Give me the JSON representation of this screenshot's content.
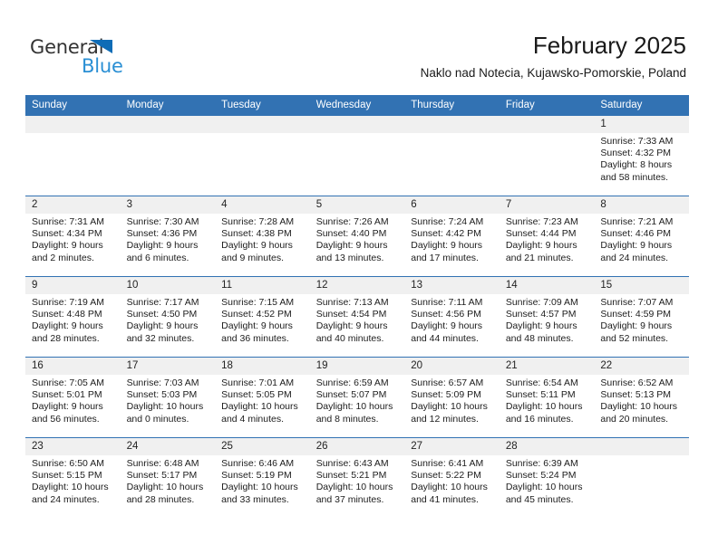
{
  "logo": {
    "word_one": "General",
    "word_two": "Blue",
    "triangle_color": "#0f6cb6",
    "blue_color": "#2a8fd4"
  },
  "header": {
    "title": "February 2025",
    "subtitle": "Naklo nad Notecia, Kujawsko-Pomorskie, Poland"
  },
  "theme": {
    "header_blue": "#3272b3",
    "daynum_gray": "#f0f0f0",
    "text": "#1c1c1c"
  },
  "calendar": {
    "weekday_headers": [
      "Sunday",
      "Monday",
      "Tuesday",
      "Wednesday",
      "Thursday",
      "Friday",
      "Saturday"
    ],
    "weeks": [
      [
        {
          "day": "",
          "blank": true
        },
        {
          "day": "",
          "blank": true
        },
        {
          "day": "",
          "blank": true
        },
        {
          "day": "",
          "blank": true
        },
        {
          "day": "",
          "blank": true
        },
        {
          "day": "",
          "blank": true
        },
        {
          "day": "1",
          "sunrise": "Sunrise: 7:33 AM",
          "sunset": "Sunset: 4:32 PM",
          "daylight": "Daylight: 8 hours and 58 minutes."
        }
      ],
      [
        {
          "day": "2",
          "sunrise": "Sunrise: 7:31 AM",
          "sunset": "Sunset: 4:34 PM",
          "daylight": "Daylight: 9 hours and 2 minutes."
        },
        {
          "day": "3",
          "sunrise": "Sunrise: 7:30 AM",
          "sunset": "Sunset: 4:36 PM",
          "daylight": "Daylight: 9 hours and 6 minutes."
        },
        {
          "day": "4",
          "sunrise": "Sunrise: 7:28 AM",
          "sunset": "Sunset: 4:38 PM",
          "daylight": "Daylight: 9 hours and 9 minutes."
        },
        {
          "day": "5",
          "sunrise": "Sunrise: 7:26 AM",
          "sunset": "Sunset: 4:40 PM",
          "daylight": "Daylight: 9 hours and 13 minutes."
        },
        {
          "day": "6",
          "sunrise": "Sunrise: 7:24 AM",
          "sunset": "Sunset: 4:42 PM",
          "daylight": "Daylight: 9 hours and 17 minutes."
        },
        {
          "day": "7",
          "sunrise": "Sunrise: 7:23 AM",
          "sunset": "Sunset: 4:44 PM",
          "daylight": "Daylight: 9 hours and 21 minutes."
        },
        {
          "day": "8",
          "sunrise": "Sunrise: 7:21 AM",
          "sunset": "Sunset: 4:46 PM",
          "daylight": "Daylight: 9 hours and 24 minutes."
        }
      ],
      [
        {
          "day": "9",
          "sunrise": "Sunrise: 7:19 AM",
          "sunset": "Sunset: 4:48 PM",
          "daylight": "Daylight: 9 hours and 28 minutes."
        },
        {
          "day": "10",
          "sunrise": "Sunrise: 7:17 AM",
          "sunset": "Sunset: 4:50 PM",
          "daylight": "Daylight: 9 hours and 32 minutes."
        },
        {
          "day": "11",
          "sunrise": "Sunrise: 7:15 AM",
          "sunset": "Sunset: 4:52 PM",
          "daylight": "Daylight: 9 hours and 36 minutes."
        },
        {
          "day": "12",
          "sunrise": "Sunrise: 7:13 AM",
          "sunset": "Sunset: 4:54 PM",
          "daylight": "Daylight: 9 hours and 40 minutes."
        },
        {
          "day": "13",
          "sunrise": "Sunrise: 7:11 AM",
          "sunset": "Sunset: 4:56 PM",
          "daylight": "Daylight: 9 hours and 44 minutes."
        },
        {
          "day": "14",
          "sunrise": "Sunrise: 7:09 AM",
          "sunset": "Sunset: 4:57 PM",
          "daylight": "Daylight: 9 hours and 48 minutes."
        },
        {
          "day": "15",
          "sunrise": "Sunrise: 7:07 AM",
          "sunset": "Sunset: 4:59 PM",
          "daylight": "Daylight: 9 hours and 52 minutes."
        }
      ],
      [
        {
          "day": "16",
          "sunrise": "Sunrise: 7:05 AM",
          "sunset": "Sunset: 5:01 PM",
          "daylight": "Daylight: 9 hours and 56 minutes."
        },
        {
          "day": "17",
          "sunrise": "Sunrise: 7:03 AM",
          "sunset": "Sunset: 5:03 PM",
          "daylight": "Daylight: 10 hours and 0 minutes."
        },
        {
          "day": "18",
          "sunrise": "Sunrise: 7:01 AM",
          "sunset": "Sunset: 5:05 PM",
          "daylight": "Daylight: 10 hours and 4 minutes."
        },
        {
          "day": "19",
          "sunrise": "Sunrise: 6:59 AM",
          "sunset": "Sunset: 5:07 PM",
          "daylight": "Daylight: 10 hours and 8 minutes."
        },
        {
          "day": "20",
          "sunrise": "Sunrise: 6:57 AM",
          "sunset": "Sunset: 5:09 PM",
          "daylight": "Daylight: 10 hours and 12 minutes."
        },
        {
          "day": "21",
          "sunrise": "Sunrise: 6:54 AM",
          "sunset": "Sunset: 5:11 PM",
          "daylight": "Daylight: 10 hours and 16 minutes."
        },
        {
          "day": "22",
          "sunrise": "Sunrise: 6:52 AM",
          "sunset": "Sunset: 5:13 PM",
          "daylight": "Daylight: 10 hours and 20 minutes."
        }
      ],
      [
        {
          "day": "23",
          "sunrise": "Sunrise: 6:50 AM",
          "sunset": "Sunset: 5:15 PM",
          "daylight": "Daylight: 10 hours and 24 minutes."
        },
        {
          "day": "24",
          "sunrise": "Sunrise: 6:48 AM",
          "sunset": "Sunset: 5:17 PM",
          "daylight": "Daylight: 10 hours and 28 minutes."
        },
        {
          "day": "25",
          "sunrise": "Sunrise: 6:46 AM",
          "sunset": "Sunset: 5:19 PM",
          "daylight": "Daylight: 10 hours and 33 minutes."
        },
        {
          "day": "26",
          "sunrise": "Sunrise: 6:43 AM",
          "sunset": "Sunset: 5:21 PM",
          "daylight": "Daylight: 10 hours and 37 minutes."
        },
        {
          "day": "27",
          "sunrise": "Sunrise: 6:41 AM",
          "sunset": "Sunset: 5:22 PM",
          "daylight": "Daylight: 10 hours and 41 minutes."
        },
        {
          "day": "28",
          "sunrise": "Sunrise: 6:39 AM",
          "sunset": "Sunset: 5:24 PM",
          "daylight": "Daylight: 10 hours and 45 minutes."
        },
        {
          "day": "",
          "blank": true
        }
      ]
    ]
  }
}
